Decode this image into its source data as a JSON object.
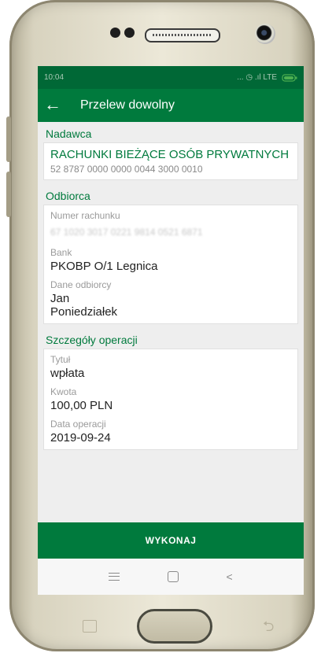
{
  "status": {
    "time": "10:04",
    "indicators": "... ◷ .ıl LTE"
  },
  "appbar": {
    "title": "Przelew dowolny"
  },
  "sender": {
    "section": "Nadawca",
    "name": "RACHUNKI BIEŻĄCE OSÓB PRYWATNYCH",
    "account": "52 8787 0000 0000 0044 3000 0010"
  },
  "recipient": {
    "section": "Odbiorca",
    "account_label": "Numer rachunku",
    "account_value": "67 1020 3017 0221 9814 0521 6871",
    "bank_label": "Bank",
    "bank_value": "PKOBP O/1 Legnica",
    "name_label": "Dane odbiorcy",
    "name_line1": "Jan",
    "name_line2": "Poniedziałek"
  },
  "details": {
    "section": "Szczegóły operacji",
    "title_label": "Tytuł",
    "title_value": "wpłata",
    "amount_label": "Kwota",
    "amount_value": "100,00 PLN",
    "date_label": "Data operacji",
    "date_value": "2019-09-24"
  },
  "actions": {
    "execute": "WYKONAJ"
  },
  "colors": {
    "brand_green": "#007a3d",
    "status_green": "#006836"
  }
}
